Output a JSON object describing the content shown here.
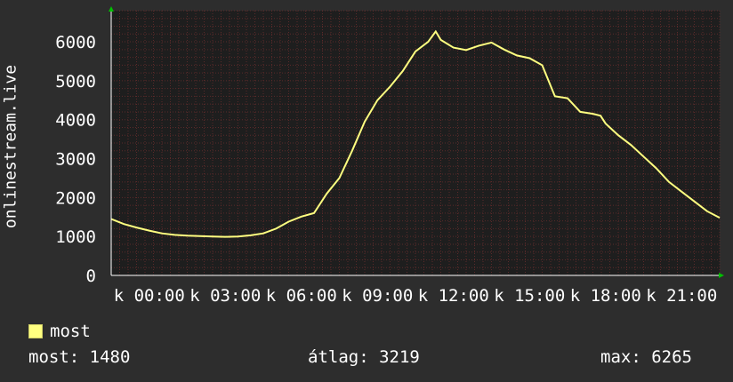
{
  "colors": {
    "background": "#2d2d2d",
    "plot_background": "#1e1e1e",
    "grid": "#5a2a2a",
    "line": "#ffff80",
    "text": "#ffffff",
    "axis_arrow": "#00c000"
  },
  "legend": {
    "label": "most"
  },
  "stats": {
    "now": "most: 1480",
    "avg": "átlag: 3219",
    "max": "max: 6265"
  },
  "chart_data": {
    "type": "line",
    "title": "",
    "ylabel": "onlinestream.live",
    "xlabel": "",
    "ylim": [
      0,
      6800
    ],
    "xlim": [
      0,
      24
    ],
    "yticks": [
      0,
      1000,
      2000,
      3000,
      4000,
      5000,
      6000
    ],
    "xtick_labels": [
      {
        "x": 1.5,
        "label": "k 00:00"
      },
      {
        "x": 4.5,
        "label": "k 03:00"
      },
      {
        "x": 7.5,
        "label": "k 06:00"
      },
      {
        "x": 10.5,
        "label": "k 09:00"
      },
      {
        "x": 13.5,
        "label": "k 12:00"
      },
      {
        "x": 16.5,
        "label": "k 15:00"
      },
      {
        "x": 19.5,
        "label": "k 18:00"
      },
      {
        "x": 22.5,
        "label": "k 21:00"
      }
    ],
    "grid": true,
    "legend_position": "bottom-left",
    "series": [
      {
        "name": "most",
        "x": [
          0,
          0.5,
          1,
          1.5,
          2,
          2.5,
          3,
          3.5,
          4,
          4.5,
          5,
          5.5,
          6,
          6.5,
          7,
          7.5,
          8,
          8.5,
          9,
          9.5,
          10,
          10.5,
          11,
          11.5,
          12,
          12.5,
          12.8,
          13,
          13.5,
          14,
          14.5,
          15,
          15.5,
          16,
          16.5,
          17,
          17.5,
          18,
          18.5,
          19,
          19.3,
          19.5,
          20,
          20.5,
          21,
          21.5,
          22,
          22.5,
          23,
          23.5,
          24
        ],
        "values": [
          1450,
          1320,
          1230,
          1150,
          1080,
          1040,
          1020,
          1010,
          1000,
          990,
          1000,
          1030,
          1080,
          1200,
          1380,
          1510,
          1600,
          2100,
          2500,
          3200,
          3950,
          4500,
          4850,
          5250,
          5750,
          6000,
          6265,
          6050,
          5850,
          5790,
          5900,
          5980,
          5800,
          5650,
          5580,
          5400,
          4600,
          4550,
          4200,
          4150,
          4100,
          3900,
          3600,
          3350,
          3050,
          2750,
          2400,
          2150,
          1900,
          1650,
          1480
        ]
      }
    ]
  }
}
